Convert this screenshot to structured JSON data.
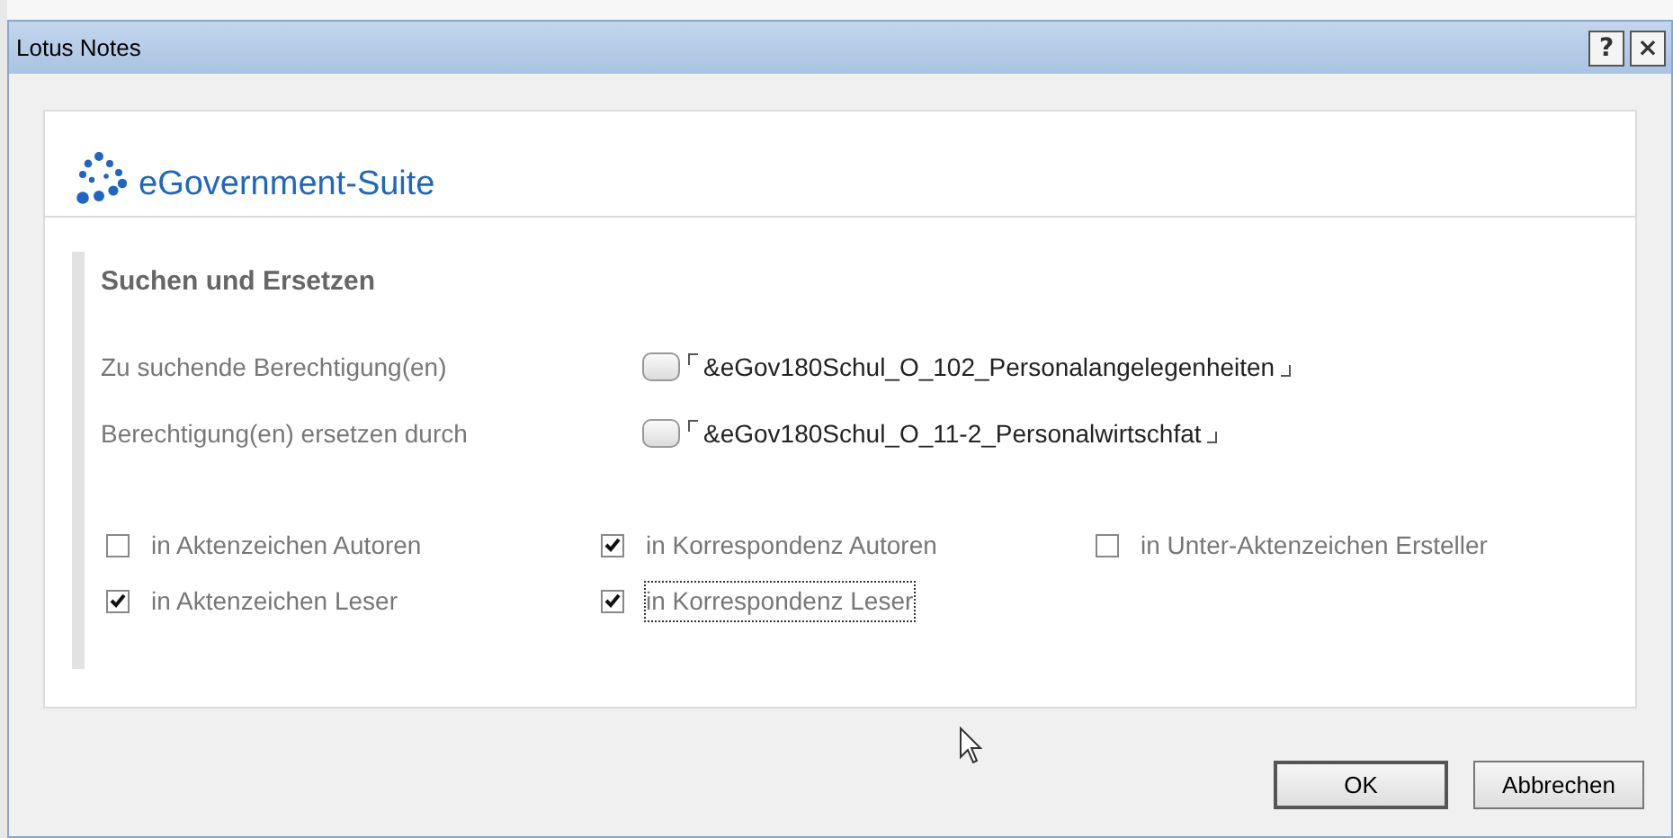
{
  "window": {
    "title": "Lotus Notes",
    "title_buttons": [
      "?",
      "×"
    ]
  },
  "logo": {
    "text": "eGovernment-Suite"
  },
  "section": {
    "heading": "Suchen und Ersetzen"
  },
  "fields": [
    {
      "label": "Zu suchende Berechtigung(en)",
      "value": "&eGov180Schul_O_102_Personalangelegenheiten"
    },
    {
      "label": "Berechtigung(en) ersetzen durch",
      "value": "&eGov180Schul_O_11-2_Personalwirtschfat"
    }
  ],
  "options": [
    {
      "label": "in Aktenzeichen Autoren",
      "checked": false,
      "focused": false
    },
    {
      "label": "in Korrespondenz Autoren",
      "checked": true,
      "focused": false
    },
    {
      "label": "in Unter-Aktenzeichen Ersteller",
      "checked": false,
      "focused": false
    },
    {
      "label": "in Aktenzeichen Leser",
      "checked": true,
      "focused": false
    },
    {
      "label": "in Korrespondenz Leser",
      "checked": true,
      "focused": true
    }
  ],
  "buttons": [
    {
      "label": "OK",
      "default": true
    },
    {
      "label": "Abbrechen",
      "default": false
    }
  ]
}
